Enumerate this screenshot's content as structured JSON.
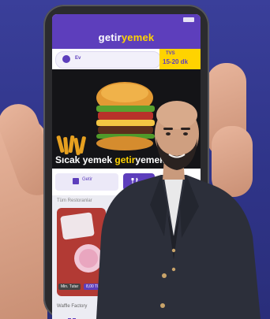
{
  "app": {
    "brand_prefix": "getir",
    "brand_suffix": "yemek"
  },
  "address_bar": {
    "text": "Ev"
  },
  "delivery_time": {
    "label": "TVS",
    "value": "15-20 dk"
  },
  "banner": {
    "text_part1": "Sıcak yemek ",
    "text_part2": "getir",
    "text_part3": "yemek"
  },
  "tabs": [
    {
      "label": "Getir"
    }
  ],
  "section": {
    "title": "Tüm Restoranlar"
  },
  "card": {
    "min_label": "Min. Tutar",
    "price_label": "8,00 TL",
    "restaurant_name": "Waffle Factory"
  },
  "colors": {
    "brand_purple": "#5d3ebc",
    "brand_yellow": "#ffd300",
    "background_blue": "#343a95",
    "suit": "#2c2f3a"
  }
}
